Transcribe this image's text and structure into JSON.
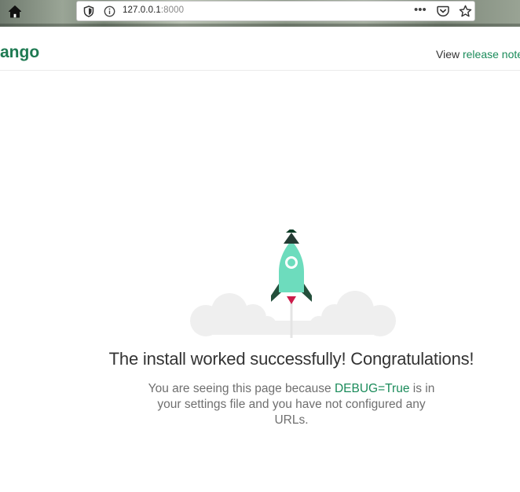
{
  "browser": {
    "url_host": "127.0.0.1",
    "url_port": ":8000",
    "more_label": "•••"
  },
  "header": {
    "logo_text": "ango",
    "release_prefix": "View",
    "release_link": "release note"
  },
  "main": {
    "title": "The install worked successfully! Congratulations!",
    "subtitle_before": "You are seeing this page because",
    "subtitle_debug": "DEBUG=True",
    "subtitle_after": "is in your settings file and you have not configured any URLs."
  }
}
